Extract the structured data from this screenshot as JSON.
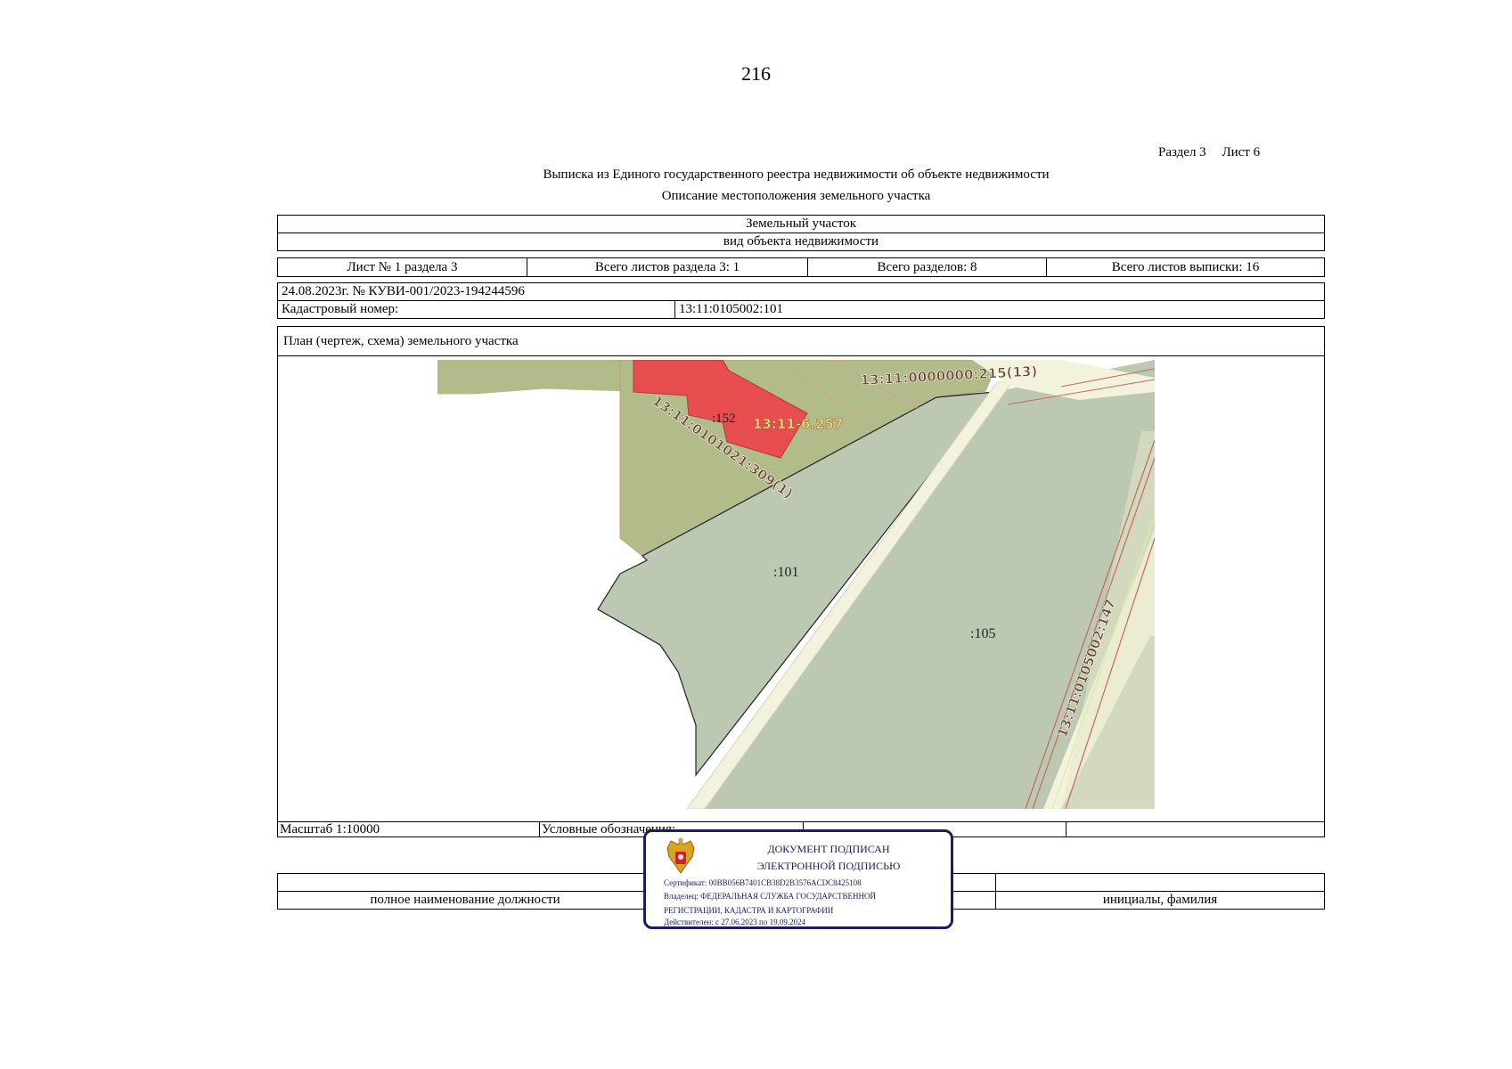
{
  "page_number": "216",
  "section_ref": {
    "section": "Раздел 3",
    "sheet": "Лист 6"
  },
  "title": "Выписка из Единого государственного реестра недвижимости об объекте недвижимости",
  "subtitle": "Описание местоположения земельного участка",
  "object_type": {
    "value": "Земельный участок",
    "caption": "вид объекта недвижимости"
  },
  "sheet_info": {
    "sheet": "Лист № 1 раздела 3",
    "sheets_in_section": "Всего листов раздела 3: 1",
    "sections_total": "Всего разделов: 8",
    "sheets_total": "Всего листов выписки: 16"
  },
  "record": {
    "date_number": "24.08.2023г. № КУВИ-001/2023-194244596",
    "cadastral_label": "Кадастровый номер:",
    "cadastral_value": "13:11:0105002:101"
  },
  "plan": {
    "heading": "План (чертеж, схема) земельного участка",
    "map_labels": {
      "label_215": "13:11:0000000:215(13)",
      "label_309": "13:11:0101021:309(1)",
      "label_152": ":152",
      "label_6257": "13:11-6.257",
      "label_101": ":101",
      "label_105": ":105",
      "label_147": "13:11:0105002:147"
    },
    "colors": {
      "parcel_fill": "#bdc8b3",
      "neighbor_fill": "#b2bb8a",
      "building_fill": "#e84d4f",
      "road_fill": "#f3f2dc",
      "boundary_line": "#c26a5c",
      "label_color": "#6b4a2e"
    }
  },
  "footer": {
    "scale": "Масштаб 1:10000",
    "legend": "Условные обозначения:",
    "position_caption": "полное наименование должности",
    "name_caption": "инициалы, фамилия"
  },
  "signature_stamp": {
    "line1": "ДОКУМЕНТ ПОДПИСАН",
    "line2": "ЭЛЕКТРОННОЙ ПОДПИСЬЮ",
    "certificate": "Сертификат: 00BB056B7401CB38D2B3576ACDC8425108",
    "owner_line1": "Владелец: ФЕДЕРАЛЬНАЯ СЛУЖБА ГОСУДАРСТВЕННОЙ",
    "owner_line2": "РЕГИСТРАЦИИ, КАДАСТРА И КАРТОГРАФИИ",
    "valid": "Действителен: с 27.06.2023 по 19.09.2024",
    "emblem_icon": "russian-eagle-emblem"
  }
}
